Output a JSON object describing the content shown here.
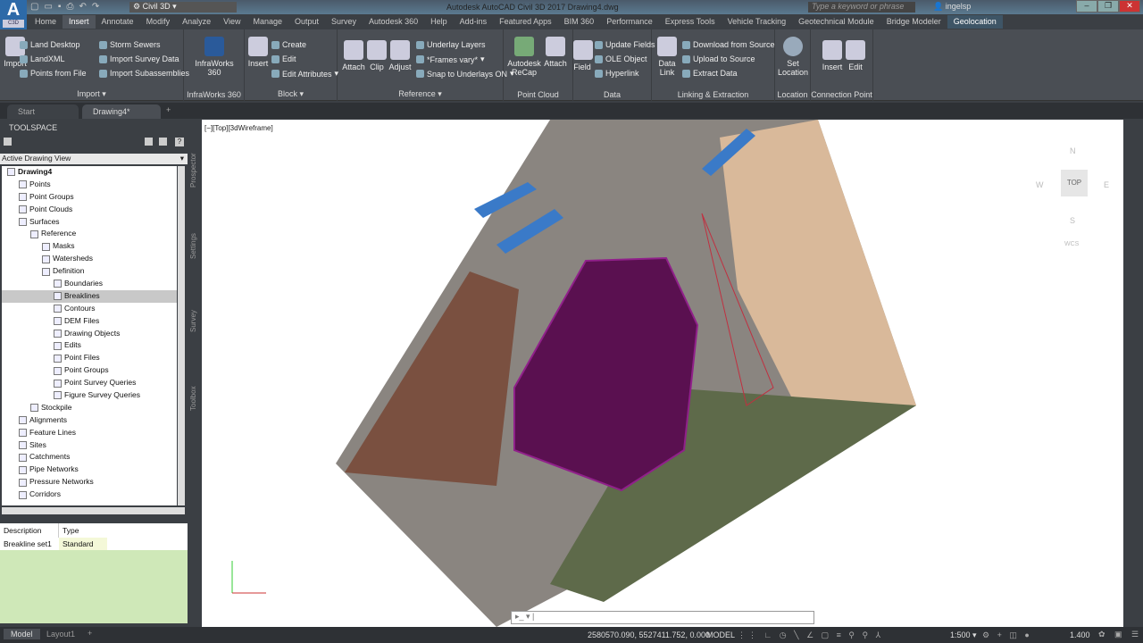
{
  "app": {
    "title": "Autodesk AutoCAD Civil 3D 2017   Drawing4.dwg",
    "workspace": "Civil 3D",
    "app_button": "A",
    "app_sub": "C3D",
    "search_placeholder": "Type a keyword or phrase",
    "user": "ingelsp"
  },
  "tabs": [
    "Home",
    "Insert",
    "Annotate",
    "Modify",
    "Analyze",
    "View",
    "Manage",
    "Output",
    "Survey",
    "Autodesk 360",
    "Help",
    "Add-ins",
    "Featured Apps",
    "BIM 360",
    "Performance",
    "Express Tools",
    "Vehicle Tracking",
    "Geotechnical Module",
    "Bridge Modeler",
    "Geolocation"
  ],
  "ribbon": {
    "import": {
      "title": "Import",
      "big": "Import",
      "items": [
        "Land Desktop",
        "LandXML",
        "Points from File",
        "Storm Sewers",
        "Import Survey Data",
        "Import Subassemblies"
      ]
    },
    "infraworks": {
      "title": "InfraWorks 360",
      "big": "InfraWorks 360"
    },
    "block": {
      "title": "Block",
      "big": "Insert",
      "items": [
        "Create",
        "Edit",
        "Edit Attributes"
      ]
    },
    "reference": {
      "title": "Reference",
      "big": [
        "Attach",
        "Clip",
        "Adjust"
      ],
      "items": [
        "Underlay Layers",
        "*Frames vary*",
        "Snap to Underlays ON"
      ]
    },
    "pointcloud": {
      "title": "Point Cloud",
      "big": [
        "Autodesk ReCap",
        "Attach"
      ]
    },
    "data": {
      "title": "Data",
      "big": "Field",
      "items": [
        "Update Fields",
        "OLE Object",
        "Hyperlink"
      ]
    },
    "linking": {
      "title": "Linking & Extraction",
      "big": "Data Link",
      "items": [
        "Download from Source",
        "Upload to Source",
        "Extract  Data"
      ]
    },
    "location": {
      "title": "Location",
      "big": "Set Location"
    },
    "connection": {
      "title": "Connection Point",
      "big": [
        "Insert",
        "Edit"
      ]
    }
  },
  "doc_tabs": [
    "Start",
    "Drawing4*"
  ],
  "toolspace": {
    "title": "TOOLSPACE",
    "view": "Active Drawing View",
    "side_tabs": [
      "Prospector",
      "Settings",
      "Survey",
      "Toolbox"
    ],
    "tree": [
      {
        "l": 0,
        "t": "Drawing4",
        "b": true
      },
      {
        "l": 1,
        "t": "Points"
      },
      {
        "l": 1,
        "t": "Point Groups"
      },
      {
        "l": 1,
        "t": "Point Clouds"
      },
      {
        "l": 1,
        "t": "Surfaces"
      },
      {
        "l": 2,
        "t": "Reference"
      },
      {
        "l": 3,
        "t": "Masks"
      },
      {
        "l": 3,
        "t": "Watersheds"
      },
      {
        "l": 3,
        "t": "Definition"
      },
      {
        "l": 4,
        "t": "Boundaries"
      },
      {
        "l": 4,
        "t": "Breaklines",
        "sel": true
      },
      {
        "l": 4,
        "t": "Contours"
      },
      {
        "l": 4,
        "t": "DEM Files"
      },
      {
        "l": 4,
        "t": "Drawing Objects"
      },
      {
        "l": 4,
        "t": "Edits"
      },
      {
        "l": 4,
        "t": "Point Files"
      },
      {
        "l": 4,
        "t": "Point Groups"
      },
      {
        "l": 4,
        "t": "Point Survey Queries"
      },
      {
        "l": 4,
        "t": "Figure Survey Queries"
      },
      {
        "l": 2,
        "t": "Stockpile"
      },
      {
        "l": 1,
        "t": "Alignments"
      },
      {
        "l": 1,
        "t": "Feature Lines"
      },
      {
        "l": 1,
        "t": "Sites"
      },
      {
        "l": 1,
        "t": "Catchments"
      },
      {
        "l": 1,
        "t": "Pipe Networks"
      },
      {
        "l": 1,
        "t": "Pressure Networks"
      },
      {
        "l": 1,
        "t": "Corridors"
      }
    ],
    "list": {
      "headers": [
        "Description",
        "Type"
      ],
      "rows": [
        [
          "Breakline set1",
          "Standard"
        ]
      ]
    }
  },
  "viewport": {
    "label": "[−][Top][3dWireframe]",
    "viewcube": {
      "top": "TOP",
      "n": "N",
      "s": "S",
      "e": "E",
      "w": "W",
      "wcs": "WCS"
    }
  },
  "status": {
    "layout_tabs": [
      "Model",
      "Layout1"
    ],
    "coords": "2580570.090, 5527411.752, 0.000",
    "model": "MODEL",
    "scale": "1:500",
    "lineweight": "1.400"
  }
}
